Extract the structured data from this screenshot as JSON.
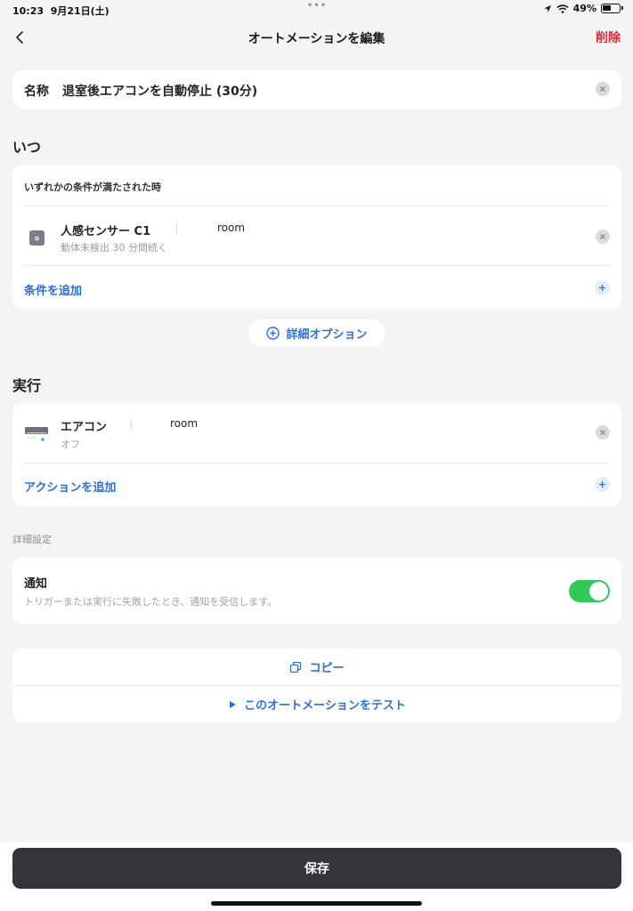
{
  "status_bar": {
    "time": "10:23",
    "date": "9月21日(土)",
    "dots": "•••",
    "battery": "49%"
  },
  "nav": {
    "title": "オートメーションを編集",
    "delete_label": "削除"
  },
  "name": {
    "label": "名称",
    "value": "退室後エアコンを自動停止 (30分)"
  },
  "when": {
    "section_title": "いつ",
    "condition_header": "いずれかの条件が満たされた時",
    "condition": {
      "device_name": "人感センサー C1",
      "room": "room",
      "detail": "動体未検出 30 分間続く",
      "icon": "motion-sensor-icon"
    },
    "add_label": "条件を追加"
  },
  "advanced_option_label": "詳細オプション",
  "execute": {
    "section_title": "実行",
    "action": {
      "device_name": "エアコン",
      "room": "room",
      "detail": "オフ",
      "icon": "air-conditioner-icon"
    },
    "add_label": "アクションを追加"
  },
  "advanced_settings": {
    "label": "詳細設定",
    "notify_title": "通知",
    "notify_desc": "トリガーまたは実行に失敗したとき、通知を受信します。",
    "notify_enabled": true
  },
  "actions": {
    "copy_label": "コピー",
    "test_label": "このオートメーションをテスト"
  },
  "save_label": "保存",
  "colors": {
    "accent": "#2e6fdb",
    "delete": "#e0262f",
    "toggle_on": "#34c759",
    "save_button": "#34363c"
  }
}
